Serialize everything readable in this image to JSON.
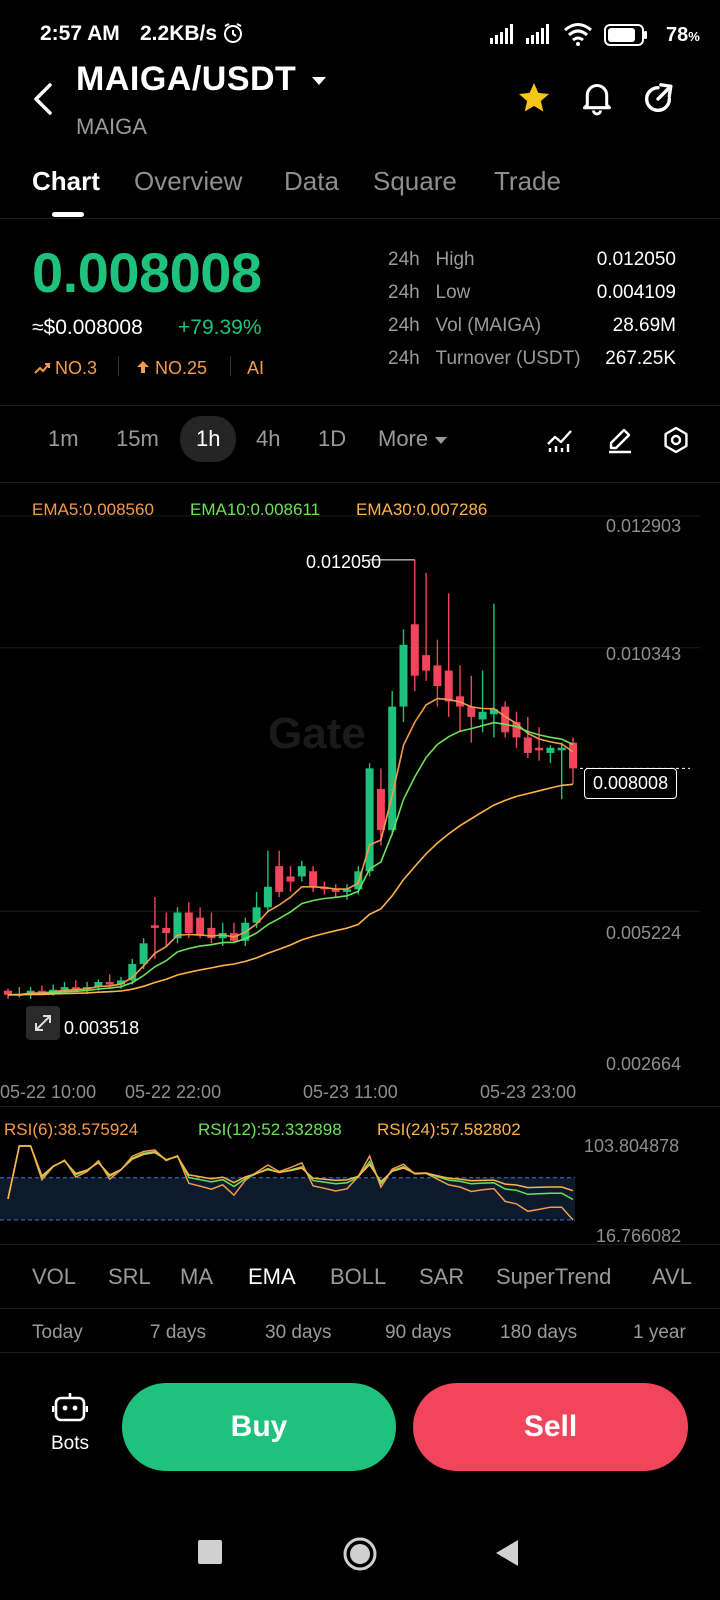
{
  "status_bar": {
    "time": "2:57 AM",
    "net_speed": "2.2KB/s",
    "battery": "78"
  },
  "header": {
    "pair": "MAIGA/USDT",
    "sub": "MAIGA"
  },
  "tabs": [
    {
      "label": "Chart",
      "active": true
    },
    {
      "label": "Overview"
    },
    {
      "label": "Data"
    },
    {
      "label": "Square"
    },
    {
      "label": "Trade"
    }
  ],
  "ticker": {
    "price": "0.008008",
    "approx": "≈$0.008008",
    "change": "+79.39%",
    "rank1": "NO.3",
    "rank2": "NO.25",
    "ai": "AI",
    "stats": [
      {
        "period": "24h",
        "label": "High",
        "value": "0.012050"
      },
      {
        "period": "24h",
        "label": "Low",
        "value": "0.004109"
      },
      {
        "period": "24h",
        "label": "Vol (MAIGA)",
        "value": "28.69M"
      },
      {
        "period": "24h",
        "label": "Turnover (USDT)",
        "value": "267.25K"
      }
    ]
  },
  "timeframes": [
    "1m",
    "15m",
    "1h",
    "4h",
    "1D",
    "More"
  ],
  "timeframe_active": "1h",
  "colors": {
    "up": "#1fc27d",
    "down": "#f0455b",
    "accent": "#f39b4b",
    "ema10": "#6fe05a",
    "ema30": "#ffb347",
    "star": "#f5c518"
  },
  "chart_data": {
    "type": "candlestick",
    "interval": "1h",
    "legend": [
      "EMA5:0.008560",
      "EMA10:0.008611",
      "EMA30:0.007286"
    ],
    "y_ticks": [
      "0.012903",
      "0.010343",
      "0.005224",
      "0.002664"
    ],
    "ylim": [
      0.002664,
      0.012903
    ],
    "x_ticks": [
      "05-22 10:00",
      "05-22 22:00",
      "05-23 11:00",
      "05-23 23:00"
    ],
    "high_label": "0.012050",
    "low_label": "0.003518",
    "last_price": "0.008008",
    "high_value": 0.01205,
    "low_value": 0.003518,
    "candles": [
      [
        0.00368,
        0.00372,
        0.00352,
        0.0036
      ],
      [
        0.00362,
        0.00375,
        0.00355,
        0.00362
      ],
      [
        0.00362,
        0.00375,
        0.00352,
        0.00368
      ],
      [
        0.00368,
        0.00378,
        0.0036,
        0.00365
      ],
      [
        0.00365,
        0.0038,
        0.00358,
        0.0037
      ],
      [
        0.0037,
        0.00385,
        0.00362,
        0.00375
      ],
      [
        0.00375,
        0.00388,
        0.00365,
        0.00372
      ],
      [
        0.00372,
        0.00385,
        0.00362,
        0.00375
      ],
      [
        0.00375,
        0.0039,
        0.00368,
        0.00385
      ],
      [
        0.00385,
        0.004,
        0.00375,
        0.0038
      ],
      [
        0.0038,
        0.00395,
        0.00372,
        0.00388
      ],
      [
        0.00388,
        0.0043,
        0.0038,
        0.0042
      ],
      [
        0.0042,
        0.0047,
        0.0041,
        0.0046
      ],
      [
        0.00495,
        0.0055,
        0.0043,
        0.0049
      ],
      [
        0.0049,
        0.0052,
        0.00455,
        0.0048
      ],
      [
        0.0047,
        0.0053,
        0.0046,
        0.0052
      ],
      [
        0.0052,
        0.0054,
        0.0047,
        0.0048
      ],
      [
        0.0051,
        0.0053,
        0.0047,
        0.00475
      ],
      [
        0.0049,
        0.0052,
        0.0046,
        0.0047
      ],
      [
        0.0047,
        0.005,
        0.00455,
        0.0048
      ],
      [
        0.0048,
        0.005,
        0.0046,
        0.00465
      ],
      [
        0.00465,
        0.0051,
        0.00455,
        0.005
      ],
      [
        0.005,
        0.0056,
        0.0049,
        0.0053
      ],
      [
        0.0053,
        0.0064,
        0.0052,
        0.0057
      ],
      [
        0.0061,
        0.0064,
        0.0055,
        0.0056
      ],
      [
        0.0059,
        0.0061,
        0.0056,
        0.0058
      ],
      [
        0.0059,
        0.0062,
        0.0058,
        0.0061
      ],
      [
        0.006,
        0.0061,
        0.0056,
        0.0057
      ],
      [
        0.0057,
        0.0058,
        0.00555,
        0.00565
      ],
      [
        0.00565,
        0.00575,
        0.0055,
        0.0056
      ],
      [
        0.0056,
        0.00575,
        0.00545,
        0.00565
      ],
      [
        0.00565,
        0.0061,
        0.00555,
        0.006
      ],
      [
        0.006,
        0.0081,
        0.0059,
        0.008
      ],
      [
        0.0076,
        0.008,
        0.0065,
        0.0068
      ],
      [
        0.0068,
        0.0095,
        0.0067,
        0.0092
      ],
      [
        0.0092,
        0.0107,
        0.0089,
        0.0104
      ],
      [
        0.0108,
        0.01205,
        0.0095,
        0.0098
      ],
      [
        0.0102,
        0.0118,
        0.0097,
        0.0099
      ],
      [
        0.01,
        0.0105,
        0.0092,
        0.0096
      ],
      [
        0.0099,
        0.0114,
        0.009,
        0.0093
      ],
      [
        0.0094,
        0.01,
        0.0087,
        0.0092
      ],
      [
        0.0092,
        0.0098,
        0.0085,
        0.009
      ],
      [
        0.00895,
        0.0099,
        0.0087,
        0.0091
      ],
      [
        0.00905,
        0.0112,
        0.0086,
        0.00915
      ],
      [
        0.0092,
        0.0093,
        0.0086,
        0.0087
      ],
      [
        0.0089,
        0.0091,
        0.0084,
        0.0086
      ],
      [
        0.0086,
        0.009,
        0.0082,
        0.0083
      ],
      [
        0.0084,
        0.0088,
        0.00815,
        0.00835
      ],
      [
        0.0083,
        0.00845,
        0.0081,
        0.0084
      ],
      [
        0.00835,
        0.0085,
        0.0074,
        0.0084
      ],
      [
        0.0085,
        0.0086,
        0.0077,
        0.008
      ]
    ]
  },
  "rsi": {
    "legend": [
      "RSI(6):38.575924",
      "RSI(12):52.332898",
      "RSI(24):57.582802"
    ],
    "ticks": [
      "103.804878",
      "16.766082"
    ]
  },
  "indicators": [
    "VOL",
    "SRL",
    "MA",
    "EMA",
    "BOLL",
    "SAR",
    "SuperTrend",
    "AVL"
  ],
  "indicator_active": "EMA",
  "ranges": [
    "Today",
    "7 days",
    "30 days",
    "90 days",
    "180 days",
    "1 year"
  ],
  "bottom": {
    "bots": "Bots",
    "buy": "Buy",
    "sell": "Sell"
  }
}
